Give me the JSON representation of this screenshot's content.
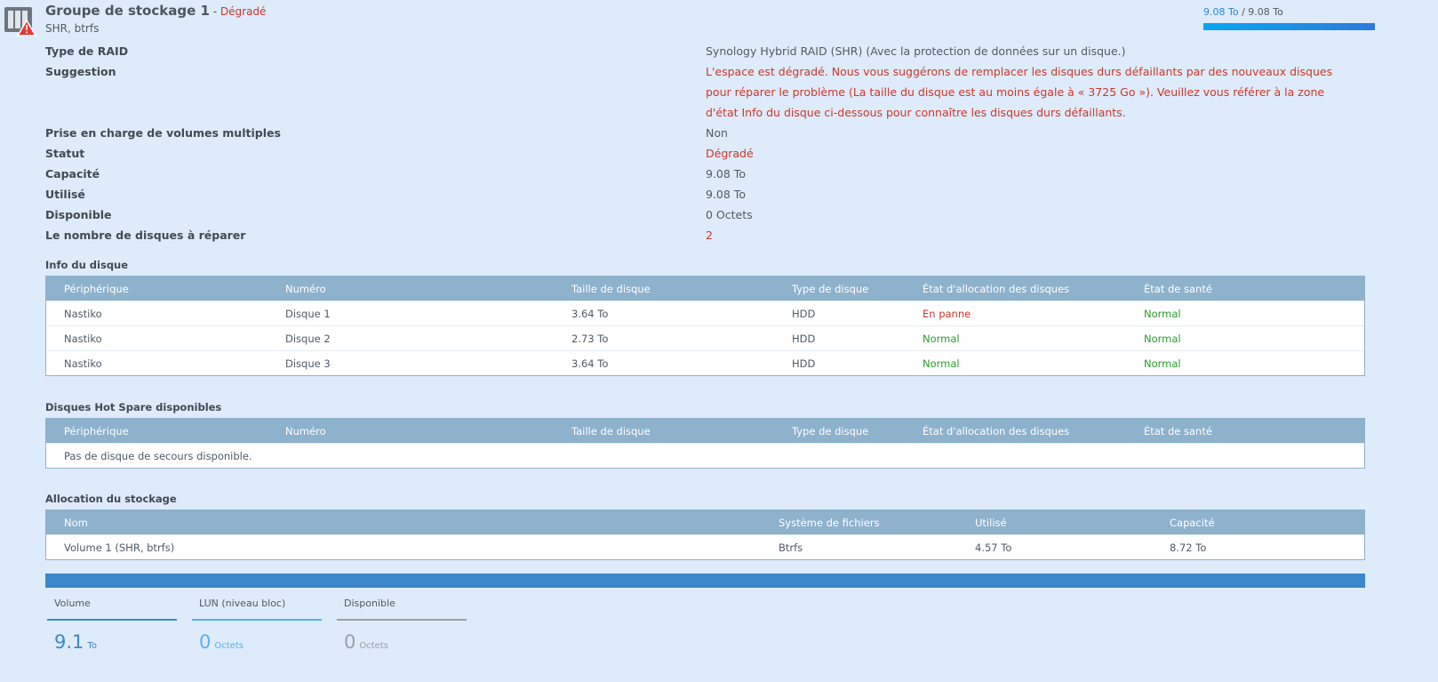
{
  "header": {
    "title": "Groupe de stockage 1",
    "separator": " - ",
    "status": "Dégradé",
    "subtitle": "SHR, btrfs",
    "used": "9.08 To",
    "slash": " / ",
    "total": "9.08 To",
    "usage_fraction": 1.0
  },
  "info": [
    {
      "label": "Type de RAID",
      "value": "Synology Hybrid RAID (SHR) (Avec la protection de données sur un disque.)",
      "color": "normal"
    },
    {
      "label": "Suggestion",
      "value": "L'espace est dégradé. Nous vous suggérons de remplacer les disques durs défaillants par des nouveaux disques pour réparer le problème (La taille du disque est au moins égale à « 3725 Go »). Veuillez vous référer à la zone d'état Info du disque ci-dessous pour connaître les disques durs défaillants.",
      "color": "red"
    },
    {
      "label": "Prise en charge de volumes multiples",
      "value": "Non",
      "color": "normal"
    },
    {
      "label": "Statut",
      "value": "Dégradé",
      "color": "red"
    },
    {
      "label": "Capacité",
      "value": "9.08 To",
      "color": "normal"
    },
    {
      "label": "Utilisé",
      "value": "9.08 To",
      "color": "normal"
    },
    {
      "label": "Disponible",
      "value": "0 Octets",
      "color": "normal"
    },
    {
      "label": "Le nombre de disques à réparer",
      "value": "2",
      "color": "red"
    }
  ],
  "disk_info": {
    "title": "Info du disque",
    "headers": [
      "Périphérique",
      "Numéro",
      "Taille de disque",
      "Type de disque",
      "État d'allocation des disques",
      "État de santé"
    ],
    "rows": [
      [
        "Nastiko",
        "Disque 1",
        "3.64 To",
        "HDD",
        "En panne",
        "Normal"
      ],
      [
        "Nastiko",
        "Disque 2",
        "2.73 To",
        "HDD",
        "Normal",
        "Normal"
      ],
      [
        "Nastiko",
        "Disque 3",
        "3.64 To",
        "HDD",
        "Normal",
        "Normal"
      ]
    ]
  },
  "hot_spare": {
    "title": "Disques Hot Spare disponibles",
    "headers": [
      "Périphérique",
      "Numéro",
      "Taille de disque",
      "Type de disque",
      "État d'allocation des disques",
      "État de santé"
    ],
    "empty": "Pas de disque de secours disponible."
  },
  "allocation": {
    "title": "Allocation du stockage",
    "headers": [
      "Nom",
      "Système de fichiers",
      "Utilisé",
      "Capacité"
    ],
    "rows": [
      [
        "Volume 1 (SHR, btrfs)",
        "Btrfs",
        "4.57 To",
        "8.72 To"
      ]
    ]
  },
  "legend": [
    {
      "label": "Volume",
      "value": "9.1",
      "unit": "To",
      "color": "#3c86cc"
    },
    {
      "label": "LUN (niveau bloc)",
      "value": "0",
      "unit": "Octets",
      "color": "#5ab0f0"
    },
    {
      "label": "Disponible",
      "value": "0",
      "unit": "Octets",
      "color": "#9aa0a6"
    }
  ]
}
